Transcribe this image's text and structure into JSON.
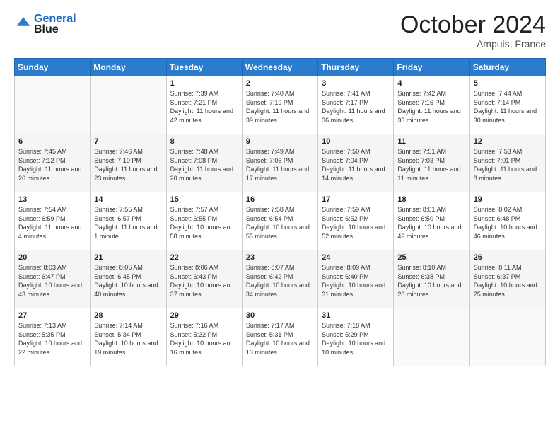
{
  "header": {
    "logo_line1": "General",
    "logo_line2": "Blue",
    "month": "October 2024",
    "location": "Ampuis, France"
  },
  "weekdays": [
    "Sunday",
    "Monday",
    "Tuesday",
    "Wednesday",
    "Thursday",
    "Friday",
    "Saturday"
  ],
  "weeks": [
    [
      {
        "day": "",
        "info": ""
      },
      {
        "day": "",
        "info": ""
      },
      {
        "day": "1",
        "info": "Sunrise: 7:39 AM\nSunset: 7:21 PM\nDaylight: 11 hours and 42 minutes."
      },
      {
        "day": "2",
        "info": "Sunrise: 7:40 AM\nSunset: 7:19 PM\nDaylight: 11 hours and 39 minutes."
      },
      {
        "day": "3",
        "info": "Sunrise: 7:41 AM\nSunset: 7:17 PM\nDaylight: 11 hours and 36 minutes."
      },
      {
        "day": "4",
        "info": "Sunrise: 7:42 AM\nSunset: 7:16 PM\nDaylight: 11 hours and 33 minutes."
      },
      {
        "day": "5",
        "info": "Sunrise: 7:44 AM\nSunset: 7:14 PM\nDaylight: 11 hours and 30 minutes."
      }
    ],
    [
      {
        "day": "6",
        "info": "Sunrise: 7:45 AM\nSunset: 7:12 PM\nDaylight: 11 hours and 26 minutes."
      },
      {
        "day": "7",
        "info": "Sunrise: 7:46 AM\nSunset: 7:10 PM\nDaylight: 11 hours and 23 minutes."
      },
      {
        "day": "8",
        "info": "Sunrise: 7:48 AM\nSunset: 7:08 PM\nDaylight: 11 hours and 20 minutes."
      },
      {
        "day": "9",
        "info": "Sunrise: 7:49 AM\nSunset: 7:06 PM\nDaylight: 11 hours and 17 minutes."
      },
      {
        "day": "10",
        "info": "Sunrise: 7:50 AM\nSunset: 7:04 PM\nDaylight: 11 hours and 14 minutes."
      },
      {
        "day": "11",
        "info": "Sunrise: 7:51 AM\nSunset: 7:03 PM\nDaylight: 11 hours and 11 minutes."
      },
      {
        "day": "12",
        "info": "Sunrise: 7:53 AM\nSunset: 7:01 PM\nDaylight: 11 hours and 8 minutes."
      }
    ],
    [
      {
        "day": "13",
        "info": "Sunrise: 7:54 AM\nSunset: 6:59 PM\nDaylight: 11 hours and 4 minutes."
      },
      {
        "day": "14",
        "info": "Sunrise: 7:55 AM\nSunset: 6:57 PM\nDaylight: 11 hours and 1 minute."
      },
      {
        "day": "15",
        "info": "Sunrise: 7:57 AM\nSunset: 6:55 PM\nDaylight: 10 hours and 58 minutes."
      },
      {
        "day": "16",
        "info": "Sunrise: 7:58 AM\nSunset: 6:54 PM\nDaylight: 10 hours and 55 minutes."
      },
      {
        "day": "17",
        "info": "Sunrise: 7:59 AM\nSunset: 6:52 PM\nDaylight: 10 hours and 52 minutes."
      },
      {
        "day": "18",
        "info": "Sunrise: 8:01 AM\nSunset: 6:50 PM\nDaylight: 10 hours and 49 minutes."
      },
      {
        "day": "19",
        "info": "Sunrise: 8:02 AM\nSunset: 6:48 PM\nDaylight: 10 hours and 46 minutes."
      }
    ],
    [
      {
        "day": "20",
        "info": "Sunrise: 8:03 AM\nSunset: 6:47 PM\nDaylight: 10 hours and 43 minutes."
      },
      {
        "day": "21",
        "info": "Sunrise: 8:05 AM\nSunset: 6:45 PM\nDaylight: 10 hours and 40 minutes."
      },
      {
        "day": "22",
        "info": "Sunrise: 8:06 AM\nSunset: 6:43 PM\nDaylight: 10 hours and 37 minutes."
      },
      {
        "day": "23",
        "info": "Sunrise: 8:07 AM\nSunset: 6:42 PM\nDaylight: 10 hours and 34 minutes."
      },
      {
        "day": "24",
        "info": "Sunrise: 8:09 AM\nSunset: 6:40 PM\nDaylight: 10 hours and 31 minutes."
      },
      {
        "day": "25",
        "info": "Sunrise: 8:10 AM\nSunset: 6:38 PM\nDaylight: 10 hours and 28 minutes."
      },
      {
        "day": "26",
        "info": "Sunrise: 8:11 AM\nSunset: 6:37 PM\nDaylight: 10 hours and 25 minutes."
      }
    ],
    [
      {
        "day": "27",
        "info": "Sunrise: 7:13 AM\nSunset: 5:35 PM\nDaylight: 10 hours and 22 minutes."
      },
      {
        "day": "28",
        "info": "Sunrise: 7:14 AM\nSunset: 5:34 PM\nDaylight: 10 hours and 19 minutes."
      },
      {
        "day": "29",
        "info": "Sunrise: 7:16 AM\nSunset: 5:32 PM\nDaylight: 10 hours and 16 minutes."
      },
      {
        "day": "30",
        "info": "Sunrise: 7:17 AM\nSunset: 5:31 PM\nDaylight: 10 hours and 13 minutes."
      },
      {
        "day": "31",
        "info": "Sunrise: 7:18 AM\nSunset: 5:29 PM\nDaylight: 10 hours and 10 minutes."
      },
      {
        "day": "",
        "info": ""
      },
      {
        "day": "",
        "info": ""
      }
    ]
  ]
}
